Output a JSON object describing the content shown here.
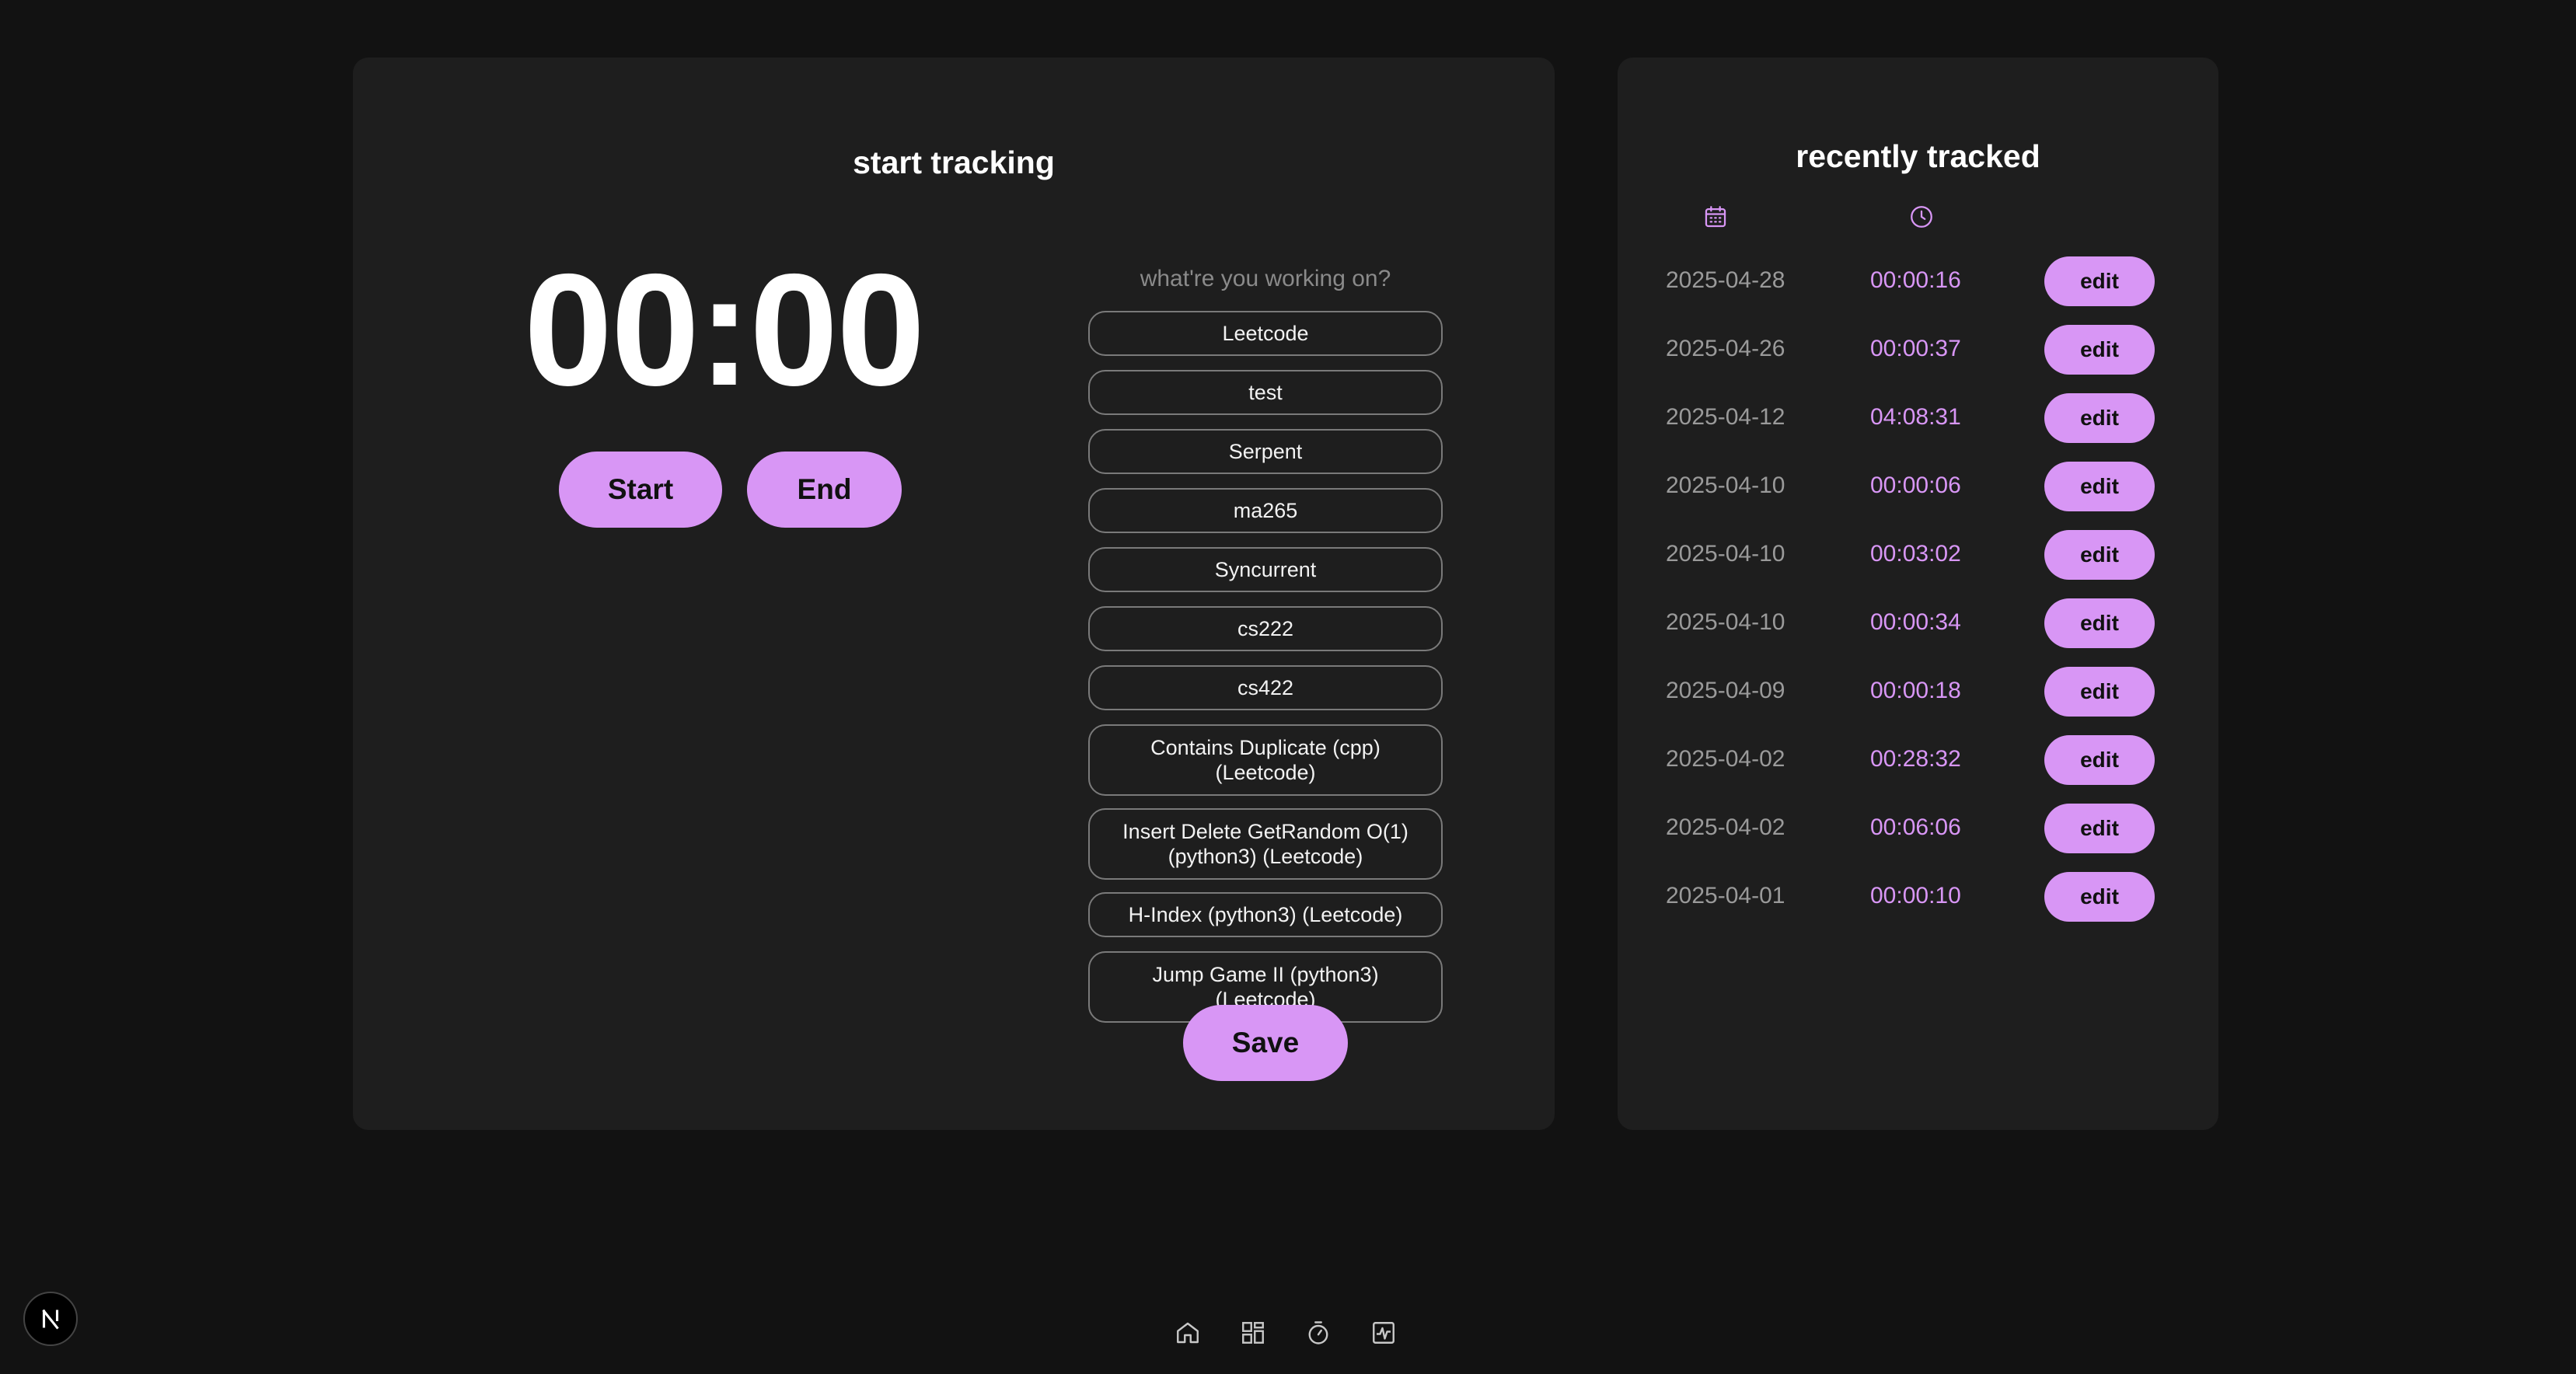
{
  "tracker": {
    "title": "start tracking",
    "timer": "00:00",
    "start_label": "Start",
    "end_label": "End",
    "prompt": "what're you working on?",
    "projects": [
      "Leetcode",
      "test",
      "Serpent",
      "ma265",
      "Syncurrent",
      "cs222",
      "cs422",
      "Contains Duplicate (cpp) (Leetcode)",
      "Insert Delete GetRandom O(1) (python3) (Leetcode)",
      "H-Index (python3) (Leetcode)",
      "Jump Game II (python3) (Leetcode)"
    ],
    "save_label": "Save"
  },
  "recent": {
    "title": "recently tracked",
    "date_column_icon": "calendar-icon",
    "duration_column_icon": "clock-icon",
    "entries": [
      {
        "date": "2025-04-28",
        "duration": "00:00:16",
        "action": "edit"
      },
      {
        "date": "2025-04-26",
        "duration": "00:00:37",
        "action": "edit"
      },
      {
        "date": "2025-04-12",
        "duration": "04:08:31",
        "action": "edit"
      },
      {
        "date": "2025-04-10",
        "duration": "00:00:06",
        "action": "edit"
      },
      {
        "date": "2025-04-10",
        "duration": "00:03:02",
        "action": "edit"
      },
      {
        "date": "2025-04-10",
        "duration": "00:00:34",
        "action": "edit"
      },
      {
        "date": "2025-04-09",
        "duration": "00:00:18",
        "action": "edit"
      },
      {
        "date": "2025-04-02",
        "duration": "00:28:32",
        "action": "edit"
      },
      {
        "date": "2025-04-02",
        "duration": "00:06:06",
        "action": "edit"
      },
      {
        "date": "2025-04-01",
        "duration": "00:00:10",
        "action": "edit"
      }
    ]
  },
  "nav": {
    "items": [
      "home-icon",
      "dashboard-icon",
      "stopwatch-icon",
      "activity-icon"
    ]
  },
  "colors": {
    "accent": "#d896f5",
    "background": "#121212",
    "panel": "#1e1e1e"
  }
}
